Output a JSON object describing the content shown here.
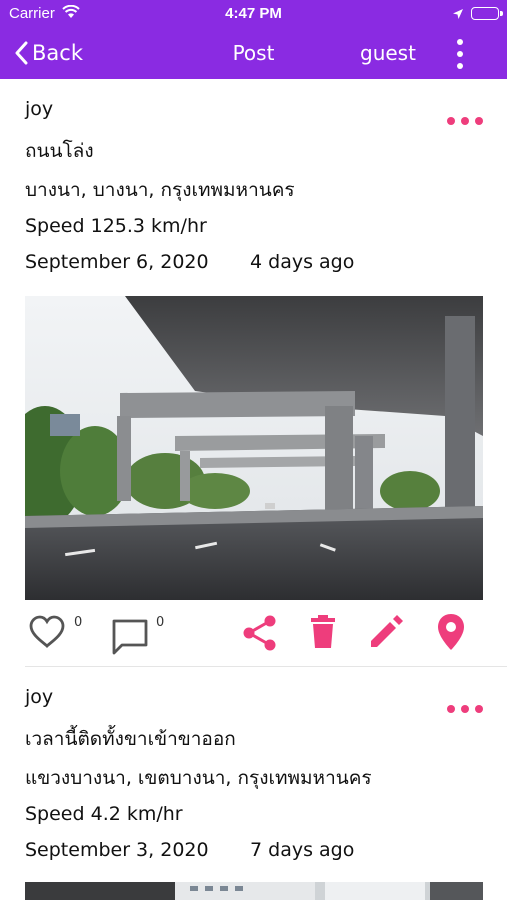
{
  "status_bar": {
    "carrier": "Carrier",
    "time": "4:47 PM"
  },
  "nav": {
    "back_label": "Back",
    "title": "Post",
    "user": "guest"
  },
  "colors": {
    "header": "#8a2be2",
    "accent": "#ee3d7c"
  },
  "posts": [
    {
      "author": "joy",
      "title": "ถนนโล่ง",
      "location": "บางนา, บางนา, กรุงเทพมหานคร",
      "speed": "Speed 125.3 km/hr",
      "date": "September 6, 2020",
      "ago": "4 days ago",
      "likes": "0",
      "comments": "0"
    },
    {
      "author": "joy",
      "title": "เวลานี้ติดทั้งขาเข้าขาออก",
      "location": "แขวงบางนา, เขตบางนา, กรุงเทพมหานคร",
      "speed": "Speed 4.2 km/hr",
      "date": "September 3, 2020",
      "ago": "7 days ago"
    }
  ],
  "icons": [
    "wifi-icon",
    "location-arrow-icon",
    "battery-icon",
    "chevron-left-icon",
    "more-vertical-icon",
    "more-horizontal-icon",
    "heart-icon",
    "comment-icon",
    "share-icon",
    "trash-icon",
    "edit-icon",
    "map-pin-icon"
  ]
}
